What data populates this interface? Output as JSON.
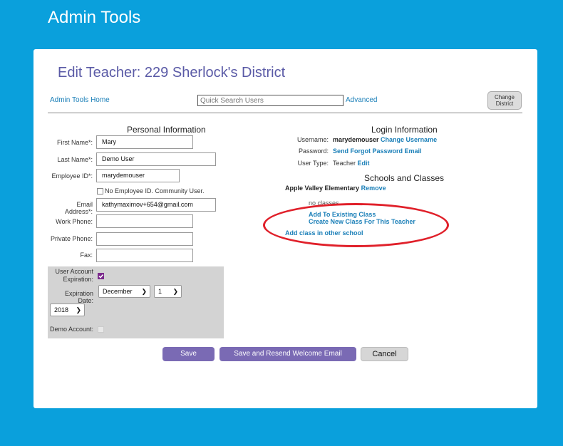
{
  "header": {
    "app_title": "Admin Tools"
  },
  "page": {
    "title": "Edit Teacher: 229 Sherlock's District"
  },
  "toolbar": {
    "home_link": "Admin Tools Home",
    "search_placeholder": "Quick Search Users",
    "advanced_link": "Advanced",
    "change_district_line1": "Change",
    "change_district_line2": "District"
  },
  "personal": {
    "heading": "Personal Information",
    "first_name_label": "First Name*:",
    "first_name_value": "Mary",
    "last_name_label": "Last Name*:",
    "last_name_value": "Demo User",
    "employee_id_label": "Employee ID*:",
    "employee_id_value": "marydemouser",
    "no_employee_id_label": "No Employee ID. Community User.",
    "email_label": "Email Address*:",
    "email_value": "kathymaximov+654@gmail.com",
    "work_phone_label": "Work Phone:",
    "private_phone_label": "Private Phone:",
    "fax_label": "Fax:",
    "expiration_label_line1": "User Account",
    "expiration_label_line2": "Expiration:",
    "expiration_date_label": "Expiration Date:",
    "month_value": "December",
    "day_value": "1",
    "year_value": "2018",
    "demo_account_label": "Demo Account:"
  },
  "login": {
    "heading": "Login Information",
    "username_label": "Username:",
    "username_value": "marydemouser",
    "change_username_link": "Change Username",
    "password_label": "Password:",
    "send_password_link": "Send Forgot Password Email",
    "user_type_label": "User Type:",
    "user_type_value": "Teacher",
    "edit_link": "Edit"
  },
  "schools": {
    "heading": "Schools and Classes",
    "school_name": "Apple Valley Elementary",
    "remove_link": "Remove",
    "no_classes": "no classes",
    "add_existing_link": "Add To Existing Class",
    "create_class_link": "Create New Class For This Teacher",
    "add_other_school_link": "Add class in other school"
  },
  "buttons": {
    "save": "Save",
    "save_resend": "Save and Resend Welcome Email",
    "cancel": "Cancel"
  },
  "colors": {
    "background": "#0aa0dc",
    "title": "#5a5aa6",
    "link": "#1a7fb8",
    "button_primary": "#7a6ab4",
    "annotation": "#e0202a"
  }
}
